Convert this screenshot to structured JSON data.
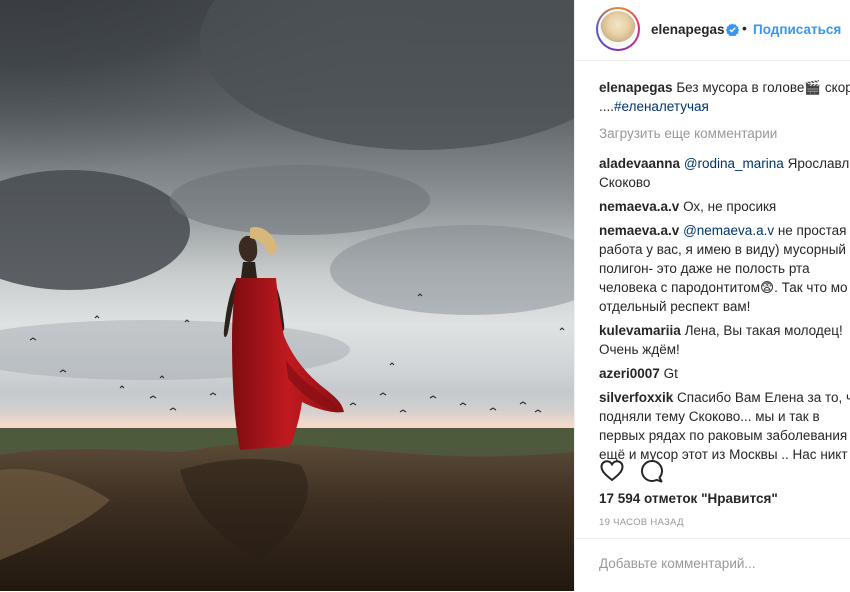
{
  "post": {
    "username": "elenapegas",
    "follow_label": "Подписаться",
    "dot": "•"
  },
  "comments": {
    "caption": {
      "user": "elenapegas",
      "line1": "Без мусора в голове🎬 скор",
      "line2_prefix": "....",
      "hashtag": "#еленалетучая"
    },
    "load_more": "Загрузить еще комментарии",
    "items": [
      {
        "user": "aladevaanna",
        "mention": "@rodina_marina",
        "lines": [
          " Ярославль",
          "Скоково"
        ]
      },
      {
        "user": "nemaeva.a.v",
        "lines": [
          " Ох, не просикя"
        ]
      },
      {
        "user": "nemaeva.a.v",
        "mention": "@nemaeva.a.v",
        "lines": [
          " не простая",
          "работа у вас, я имею в виду) мусорный",
          "полигон- это даже не полость рта",
          "человека с пародонтитом😨. Так что мо",
          "отдельный респект вам!"
        ]
      },
      {
        "user": "kulevamariia",
        "lines": [
          " Лена, Вы такая молодец!",
          "Очень ждём!"
        ]
      },
      {
        "user": "azeri0007",
        "lines": [
          " Gt"
        ]
      },
      {
        "user": "silverfoxxik",
        "lines": [
          " Спасибо Вам Елена за то, чт",
          "подняли тему Скоково... мы и так в",
          "первых рядах по раковым заболевания",
          "ещё и мусор этот из Москвы .. Нас никт"
        ]
      }
    ]
  },
  "actions": {
    "like_icon": "heart-icon",
    "comment_icon": "comment-icon"
  },
  "likes_text": "17 594 отметок \"Нравится\"",
  "time_text": "19 ЧАСОВ НАЗАД",
  "add_comment_placeholder": "Добавьте комментарий...",
  "colors": {
    "link": "#3897f0",
    "mention": "#003569",
    "muted": "#999999",
    "border": "#efefef",
    "dress": "#b0151c"
  }
}
